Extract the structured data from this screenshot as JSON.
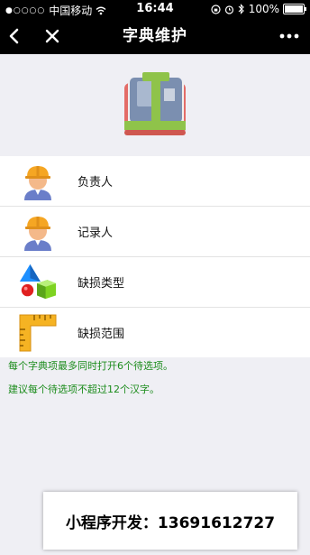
{
  "status": {
    "carrier": "中国移动",
    "time": "16:44",
    "battery": "100%",
    "battery_level": 1.0
  },
  "nav": {
    "title": "字典维护"
  },
  "list": {
    "items": [
      {
        "label": "负责人",
        "icon": "worker-icon"
      },
      {
        "label": "记录人",
        "icon": "worker-icon"
      },
      {
        "label": "缺损类型",
        "icon": "shapes-icon"
      },
      {
        "label": "缺损范围",
        "icon": "ruler-icon"
      }
    ]
  },
  "notes": [
    "每个字典项最多同时打开6个待选项。",
    "建议每个待选项不超过12个汉字。"
  ],
  "promo": {
    "text": "小程序开发：13691612727"
  },
  "colors": {
    "note_text": "#1c8c1c",
    "nav_bg": "#000000",
    "page_bg": "#efeff4"
  }
}
